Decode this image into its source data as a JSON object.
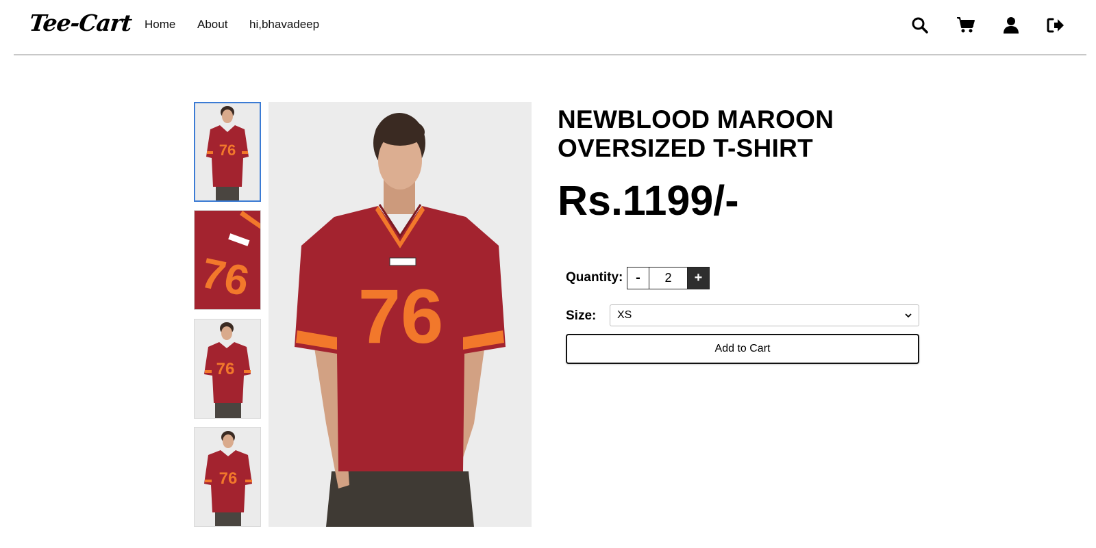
{
  "header": {
    "logo": "Tee-Cart",
    "nav": [
      {
        "label": "Home"
      },
      {
        "label": "About"
      },
      {
        "label": "hi,bhavadeep"
      }
    ],
    "icons": [
      "search-icon",
      "cart-icon",
      "user-icon",
      "logout-icon"
    ]
  },
  "product": {
    "title": "NEWBLOOD MAROON OVERSIZED T-SHIRT",
    "price": "Rs.1199/-",
    "shirt_number": "76",
    "thumbnails": [
      "front-view",
      "detail-view",
      "side-view",
      "front-view-2"
    ],
    "active_thumbnail": 0,
    "colors": {
      "shirt": "#a3232f",
      "stripe": "#f2782b",
      "background": "#ececec"
    }
  },
  "purchase": {
    "quantity_label": "Quantity:",
    "minus_label": "-",
    "quantity_value": "2",
    "plus_label": "+",
    "size_label": "Size:",
    "size_selected": "XS",
    "add_to_cart_label": "Add to Cart"
  }
}
